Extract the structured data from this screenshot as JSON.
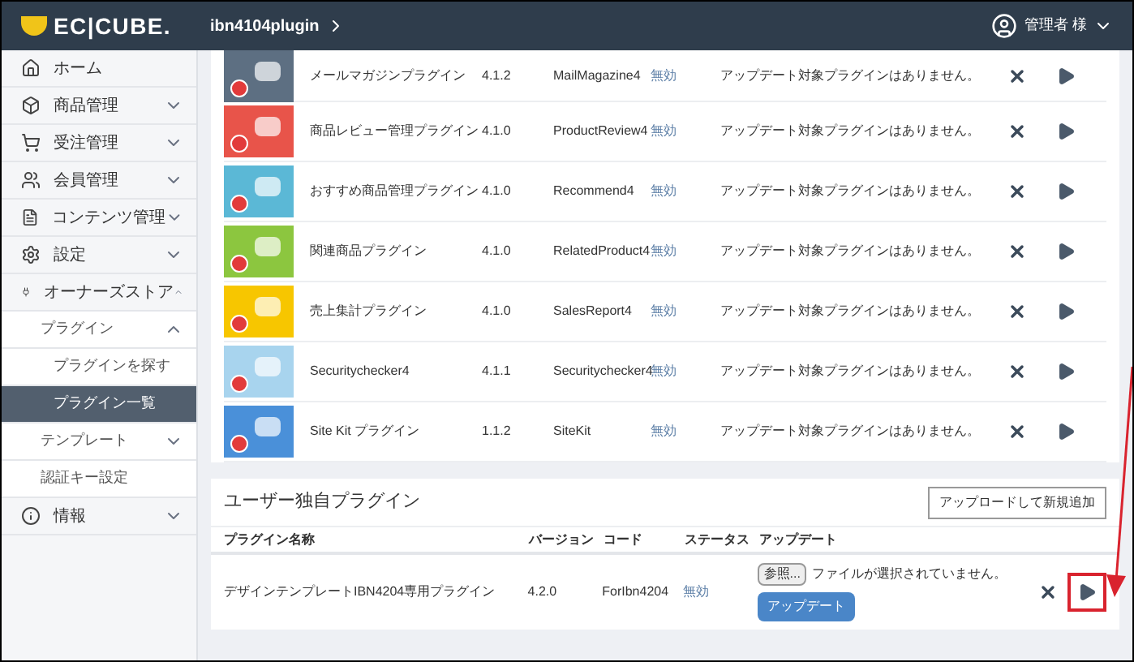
{
  "header": {
    "logo": "EC|CUBE.",
    "shop": "ibn4104plugin",
    "user": "管理者 様"
  },
  "sidebar": {
    "items": [
      {
        "label": "ホーム",
        "expandable": false,
        "selected": false
      },
      {
        "label": "商品管理",
        "expandable": true,
        "expanded": false,
        "selected": false
      },
      {
        "label": "受注管理",
        "expandable": true,
        "expanded": false,
        "selected": false
      },
      {
        "label": "会員管理",
        "expandable": true,
        "expanded": false,
        "selected": false
      },
      {
        "label": "コンテンツ管理",
        "expandable": true,
        "expanded": false,
        "selected": false
      },
      {
        "label": "設定",
        "expandable": true,
        "expanded": false,
        "selected": false
      },
      {
        "label": "オーナーズストア",
        "expandable": true,
        "expanded": true,
        "selected": false,
        "children": [
          {
            "label": "プラグイン",
            "expandable": true,
            "expanded": true,
            "selected": false,
            "children": [
              {
                "label": "プラグインを探す",
                "selected": false
              },
              {
                "label": "プラグイン一覧",
                "selected": true
              }
            ]
          },
          {
            "label": "テンプレート",
            "expandable": true,
            "expanded": false,
            "selected": false
          },
          {
            "label": "認証キー設定",
            "expandable": false,
            "selected": false
          }
        ]
      },
      {
        "label": "情報",
        "expandable": true,
        "expanded": false,
        "selected": false
      }
    ]
  },
  "store_plugins": {
    "rows": [
      {
        "name": "メールマガジンプラグイン",
        "version": "4.1.2",
        "code": "MailMagazine4",
        "status": "無効",
        "update": "アップデート対象プラグインはありません。",
        "color": "#5d6f82"
      },
      {
        "name": "商品レビュー管理プラグイン",
        "version": "4.1.0",
        "code": "ProductReview4",
        "status": "無効",
        "update": "アップデート対象プラグインはありません。",
        "color": "#e8544a"
      },
      {
        "name": "おすすめ商品管理プラグイン",
        "version": "4.1.0",
        "code": "Recommend4",
        "status": "無効",
        "update": "アップデート対象プラグインはありません。",
        "color": "#5bb8d6"
      },
      {
        "name": "関連商品プラグイン",
        "version": "4.1.0",
        "code": "RelatedProduct4",
        "status": "無効",
        "update": "アップデート対象プラグインはありません。",
        "color": "#8cc63f"
      },
      {
        "name": "売上集計プラグイン",
        "version": "4.1.0",
        "code": "SalesReport4",
        "status": "無効",
        "update": "アップデート対象プラグインはありません。",
        "color": "#f7c600"
      },
      {
        "name": "Securitychecker4",
        "version": "4.1.1",
        "code": "Securitychecker4",
        "status": "無効",
        "update": "アップデート対象プラグインはありません。",
        "color": "#a8d4ee"
      },
      {
        "name": "Site Kit プラグイン",
        "version": "1.1.2",
        "code": "SiteKit",
        "status": "無効",
        "update": "アップデート対象プラグインはありません。",
        "color": "#4a90d9"
      }
    ]
  },
  "user_plugins": {
    "title": "ユーザー独自プラグイン",
    "upload_button": "アップロードして新規追加",
    "columns": [
      "プラグイン名称",
      "バージョン",
      "コード",
      "ステータス",
      "アップデート"
    ],
    "rows": [
      {
        "name": "デザインテンプレートIBN4204専用プラグイン",
        "version": "4.2.0",
        "code": "ForIbn4204",
        "status": "無効",
        "browse_button": "参照...",
        "file_status": "ファイルが選択されていません。",
        "update_button": "アップデート",
        "highlighted": true
      }
    ]
  }
}
